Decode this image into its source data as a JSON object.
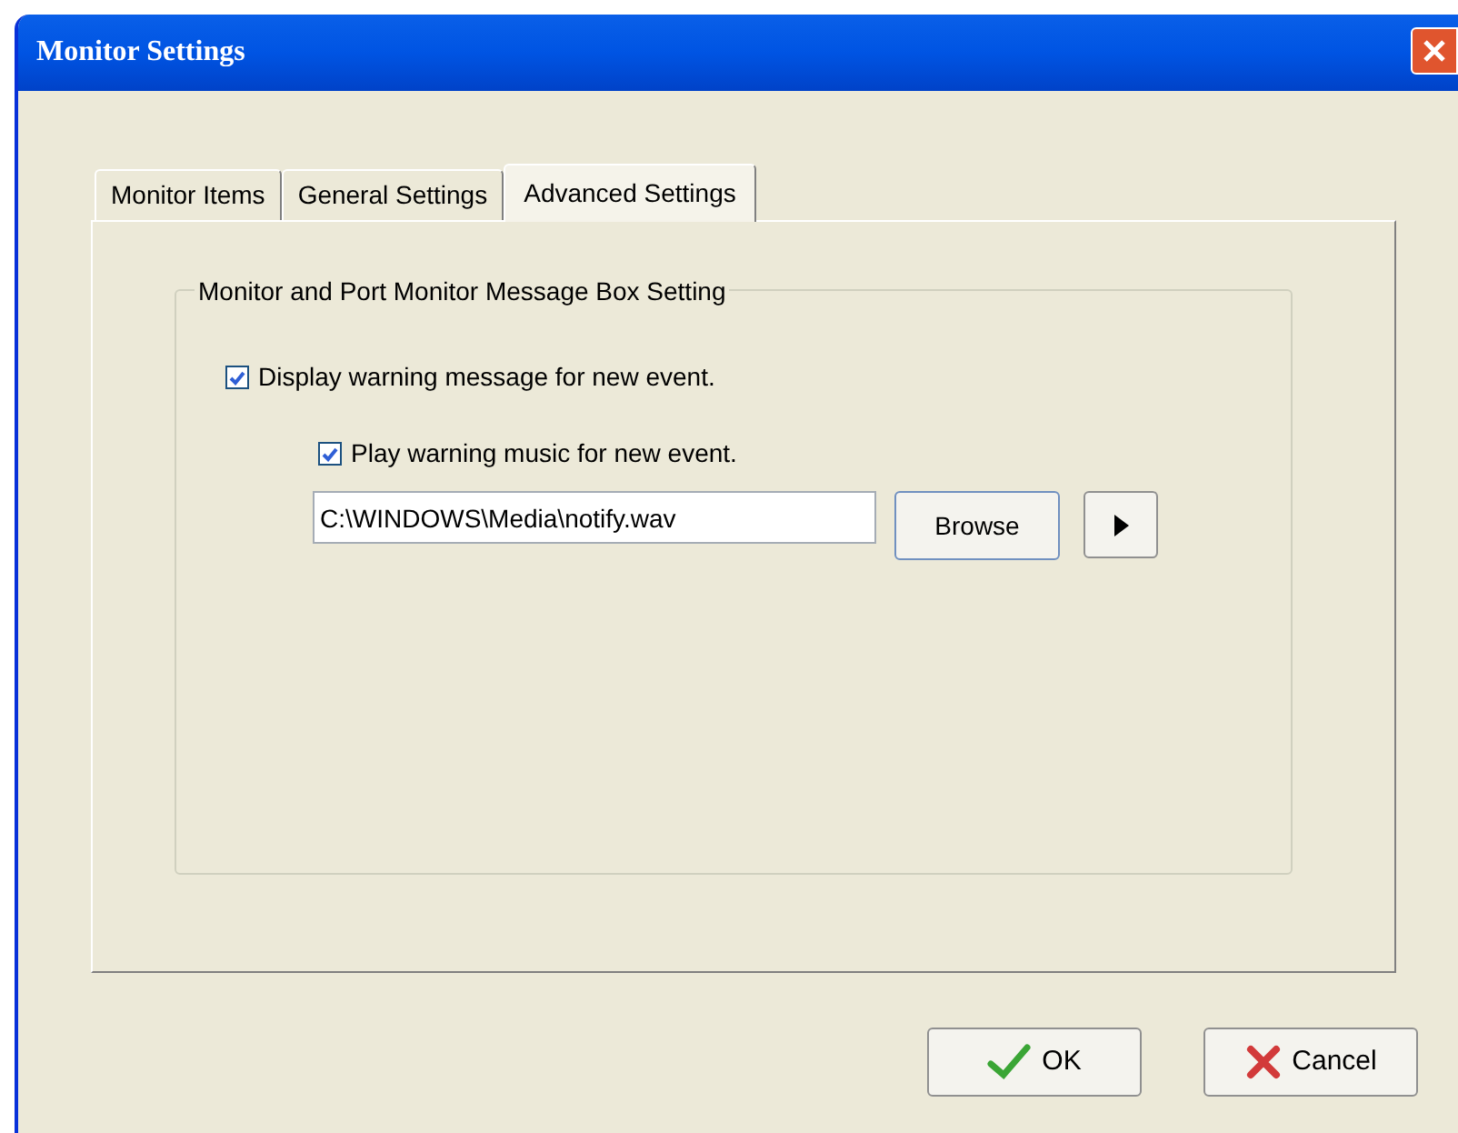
{
  "window": {
    "title": "Monitor Settings"
  },
  "tabs": [
    {
      "label": "Monitor Items",
      "selected": false
    },
    {
      "label": "General Settings",
      "selected": false
    },
    {
      "label": "Advanced Settings",
      "selected": true
    }
  ],
  "group": {
    "title": "Monitor and Port Monitor Message Box Setting",
    "display_warning": {
      "label": "Display warning message for new event.",
      "checked": true
    },
    "play_music": {
      "label": "Play warning music for new event.",
      "checked": true
    },
    "sound_file": {
      "value": "C:\\WINDOWS\\Media\\notify.wav"
    },
    "browse_button": "Browse"
  },
  "buttons": [
    {
      "kind": "ok",
      "label": "OK"
    },
    {
      "kind": "cancel",
      "label": "Cancel"
    }
  ]
}
